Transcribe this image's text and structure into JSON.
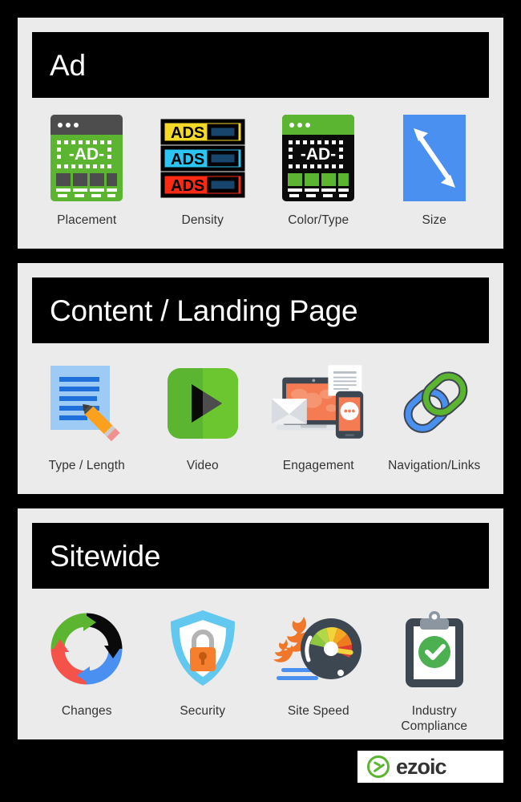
{
  "colors": {
    "background": "#000000",
    "panel_bg": "#ebebeb",
    "header_bg": "#000000",
    "header_text": "#ffffff",
    "label_text": "#333333",
    "brand_green": "#5cb531",
    "accent_blue": "#4a90f0",
    "accent_orange": "#f57f2e",
    "accent_red": "#f5524a"
  },
  "sections": [
    {
      "id": "ad",
      "title": "Ad",
      "items": [
        {
          "label": "Placement",
          "icon": "browser-ad-placement-icon"
        },
        {
          "label": "Density",
          "icon": "ads-density-bars-icon"
        },
        {
          "label": "Color/Type",
          "icon": "browser-ad-color-type-icon"
        },
        {
          "label": "Size",
          "icon": "diagonal-resize-arrow-icon"
        }
      ]
    },
    {
      "id": "content",
      "title": "Content / Landing Page",
      "items": [
        {
          "label": "Type / Length",
          "icon": "document-pencil-icon"
        },
        {
          "label": "Video",
          "icon": "play-button-icon"
        },
        {
          "label": "Engagement",
          "icon": "devices-engagement-icon"
        },
        {
          "label": "Navigation/Links",
          "icon": "chain-links-icon"
        }
      ]
    },
    {
      "id": "sitewide",
      "title": "Sitewide",
      "items": [
        {
          "label": "Changes",
          "icon": "circular-arrows-icon"
        },
        {
          "label": "Security",
          "icon": "shield-lock-icon"
        },
        {
          "label": "Site Speed",
          "icon": "speedometer-flame-icon"
        },
        {
          "label": "Industry\nCompliance",
          "icon": "clipboard-check-icon"
        }
      ]
    }
  ],
  "footer": {
    "logo_text": "ezoic",
    "logo_mark": "ezoic-circle-mark"
  },
  "ad_icon_text": {
    "ad_label": "-AD-",
    "ads_label": "ADS"
  }
}
